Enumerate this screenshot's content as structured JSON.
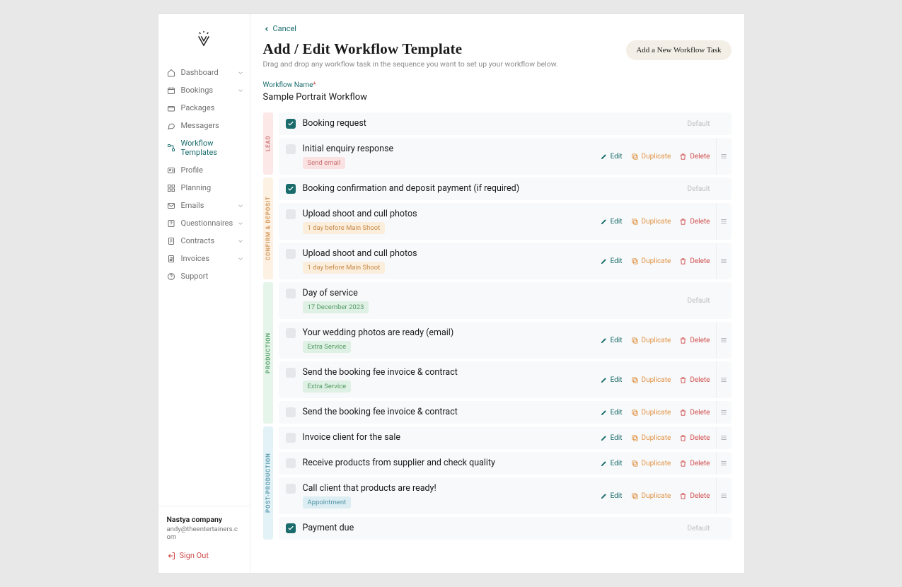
{
  "sidebar": {
    "items": [
      {
        "label": "Dashboard",
        "icon": "home",
        "expandable": true
      },
      {
        "label": "Bookings",
        "icon": "calendar",
        "expandable": true
      },
      {
        "label": "Packages",
        "icon": "box",
        "expandable": false
      },
      {
        "label": "Messagers",
        "icon": "chat",
        "expandable": false
      },
      {
        "label": "Workflow Templates",
        "icon": "flow",
        "expandable": false,
        "active": true
      },
      {
        "label": "Profile",
        "icon": "idcard",
        "expandable": false
      },
      {
        "label": "Planning",
        "icon": "grid",
        "expandable": false
      },
      {
        "label": "Emails",
        "icon": "mail",
        "expandable": true
      },
      {
        "label": "Questionnaires",
        "icon": "question",
        "expandable": true
      },
      {
        "label": "Contracts",
        "icon": "contract",
        "expandable": true
      },
      {
        "label": "Invoices",
        "icon": "invoice",
        "expandable": true
      },
      {
        "label": "Support",
        "icon": "help",
        "expandable": false
      }
    ],
    "company": "Nastya company",
    "email": "andy@theentertainers.com",
    "signout_label": "Sign Out"
  },
  "header": {
    "cancel_label": "Cancel",
    "title": "Add / Edit Workflow Template",
    "subtitle": "Drag and drop any workflow task in the sequence you want to set up your workflow below.",
    "add_button": "Add a New Workflow Task",
    "name_field_label": "Workflow Name",
    "workflow_name": "Sample Portrait Workflow"
  },
  "actions": {
    "edit": "Edit",
    "duplicate": "Duplicate",
    "delete": "Delete",
    "default": "Default"
  },
  "stages": [
    {
      "name": "LEAD",
      "class": "stage-lead",
      "tasks": [
        {
          "title": "Booking request",
          "checked": true,
          "default": true
        },
        {
          "title": "Initial enquiry response",
          "checked": false,
          "tag": {
            "text": "Send email",
            "cls": "tag-pink"
          },
          "editable": true,
          "handle": true
        }
      ]
    },
    {
      "name": "CONFIRM & DEPOSIT",
      "class": "stage-confirm",
      "tasks": [
        {
          "title": "Booking confirmation and deposit payment (if required)",
          "checked": true,
          "default": true
        },
        {
          "title": "Upload shoot and cull photos",
          "checked": false,
          "tag": {
            "text": "1 day before Main Shoot",
            "cls": "tag-orange"
          },
          "editable": true,
          "handle": true
        },
        {
          "title": "Upload shoot and cull photos",
          "checked": false,
          "tag": {
            "text": "1 day before Main Shoot",
            "cls": "tag-orange"
          },
          "editable": true,
          "handle": true
        }
      ]
    },
    {
      "name": "PRODUCTION",
      "class": "stage-prod",
      "tasks": [
        {
          "title": "Day of service",
          "checked": false,
          "tag": {
            "text": "17 December 2023",
            "cls": "tag-green"
          },
          "default": true
        },
        {
          "title": "Your wedding photos are ready (email)",
          "checked": false,
          "tag": {
            "text": "Extra Service",
            "cls": "tag-green"
          },
          "editable": true,
          "handle": true
        },
        {
          "title": "Send the booking fee invoice & contract",
          "checked": false,
          "tag": {
            "text": "Extra Service",
            "cls": "tag-green"
          },
          "editable": true,
          "handle": true
        },
        {
          "title": "Send the booking fee invoice & contract",
          "checked": false,
          "editable": true,
          "handle": true
        }
      ]
    },
    {
      "name": "POST-PRODUCTION",
      "class": "stage-post",
      "tasks": [
        {
          "title": "Invoice client for the sale",
          "checked": false,
          "editable": true,
          "handle": true
        },
        {
          "title": "Receive products from supplier and check quality",
          "checked": false,
          "editable": true,
          "handle": true
        },
        {
          "title": "Call client that products are ready!",
          "checked": false,
          "tag": {
            "text": "Appointment",
            "cls": "tag-blue"
          },
          "editable": true,
          "handle": true
        },
        {
          "title": "Payment due",
          "checked": true,
          "default": true
        }
      ]
    }
  ]
}
